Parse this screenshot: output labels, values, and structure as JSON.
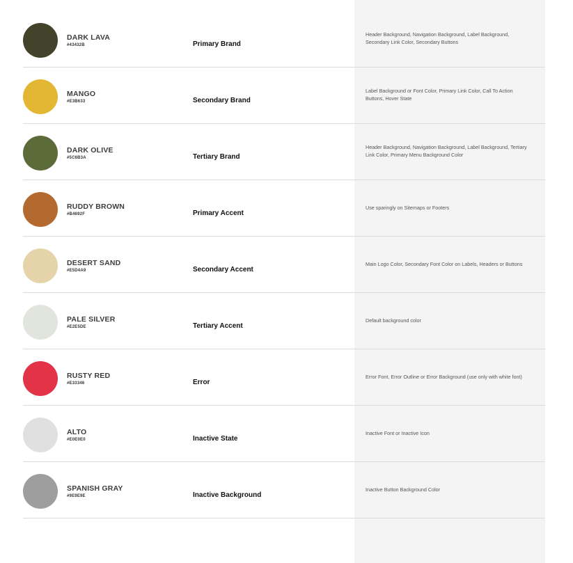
{
  "palette": [
    {
      "name": "DARK LAVA",
      "hex": "#43432B",
      "swatch": "#43432b",
      "role": "Primary Brand",
      "usage": "Header Background, Navigation Background, Label Background, Secondary Link Color, Secondary Buttons"
    },
    {
      "name": "MANGO",
      "hex": "#E3B633",
      "swatch": "#e3b633",
      "role": "Secondary Brand",
      "usage": "Label Background or Font Color, Primary Link Color, Call To Action Buttons, Hover State"
    },
    {
      "name": "DARK OLIVE",
      "hex": "#5C6B3A",
      "swatch": "#5c6b3a",
      "role": "Tertiary Brand",
      "usage": "Header Background, Navigation Background, Label Background, Tertiary Link Color, Primary Menu Background Color"
    },
    {
      "name": "RUDDY BROWN",
      "hex": "#B4692F",
      "swatch": "#b4692f",
      "role": "Primary Accent",
      "usage": "Use sparingly on Sitemaps or Footers"
    },
    {
      "name": "DESERT SAND",
      "hex": "#E5D4A9",
      "swatch": "#e5d4a9",
      "role": "Secondary Accent",
      "usage": "Main Logo Color, Secondary Font Color on Labels, Headers or Buttons"
    },
    {
      "name": "PALE SILVER",
      "hex": "#E2E5DE",
      "swatch": "#e2e5de",
      "role": "Tertiary Accent",
      "usage": "Default background color"
    },
    {
      "name": "RUSTY RED",
      "hex": "#E33346",
      "swatch": "#e33346",
      "role": "Error",
      "usage": "Error Font, Error Outline or Error Background (use only with white font)"
    },
    {
      "name": "ALTO",
      "hex": "#E0E0E0",
      "swatch": "#e0e0e0",
      "role": "Inactive State",
      "usage": "Inactive Font or Inactive Icon"
    },
    {
      "name": "SPANISH GRAY",
      "hex": "#9E9E9E",
      "swatch": "#9e9e9e",
      "role": "Inactive Background",
      "usage": "Inactive Button Background Color"
    }
  ]
}
